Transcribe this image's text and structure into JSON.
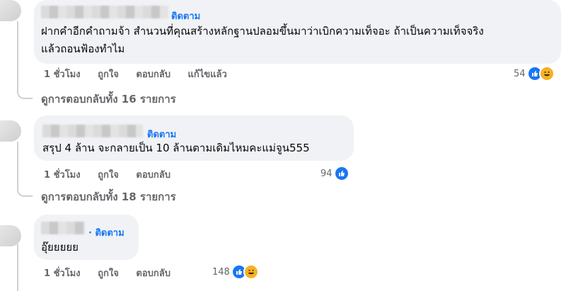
{
  "comments": [
    {
      "follow_label": "ติดตาม",
      "text_line1": "ฝากคำอีกคำถามจ้า สำนวนที่คุณสร้างหลักฐานปลอมขึ้นมาว่าเบิกความเท็จอะ ถ้าเป็นความเท็จจริง",
      "text_line2": "แล้วถอนฟ้องทำไม",
      "time": "1 ชั่วโมง",
      "like_action": "ถูกใจ",
      "reply_action": "ตอบกลับ",
      "edited": "แก้ไขแล้ว",
      "reaction_count": "54",
      "reaction_icons": [
        "like-icon",
        "haha-icon"
      ],
      "replies_link": "ดูการตอบกลับทั้ง 16 รายการ"
    },
    {
      "follow_label": "ติดตาม",
      "text_line1": "สรุป 4 ล้าน จะกลายเป็น 10 ล้านตามเดิมไหมคะแม่จูน555",
      "time": "1 ชั่วโมง",
      "like_action": "ถูกใจ",
      "reply_action": "ตอบกลับ",
      "reaction_count": "94",
      "reaction_icons": [
        "like-icon"
      ],
      "replies_link": "ดูการตอบกลับทั้ง 18 รายการ"
    },
    {
      "follow_label": "· ติดตาม",
      "text_line1": "อุ๊ยยยยย",
      "time": "1 ชั่วโมง",
      "like_action": "ถูกใจ",
      "reply_action": "ตอบกลับ",
      "reaction_count": "148",
      "reaction_icons": [
        "like-icon",
        "haha-icon"
      ]
    }
  ],
  "colors": {
    "accent": "#1877f2",
    "bubble": "#f0f2f5",
    "secondary_text": "#65676b",
    "haha": "#f7b125"
  }
}
